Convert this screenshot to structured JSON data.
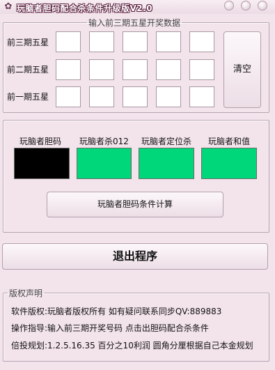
{
  "window": {
    "title": "玩脑者胆码配合杀条件升级版V2.0",
    "icon": "app-logo-icon"
  },
  "input_group": {
    "legend": "输入前三期五星开奖数据",
    "rows": [
      {
        "label": "前三期五星",
        "values": [
          "",
          "",
          "",
          "",
          ""
        ]
      },
      {
        "label": "前二期五星",
        "values": [
          "",
          "",
          "",
          "",
          ""
        ]
      },
      {
        "label": "前一期五星",
        "values": [
          "",
          "",
          "",
          "",
          ""
        ]
      }
    ],
    "clear_label": "清空"
  },
  "results": {
    "items": [
      {
        "label": "玩脑者胆码",
        "color": "#000000"
      },
      {
        "label": "玩脑者杀012",
        "color": "#00d67a"
      },
      {
        "label": "玩脑者定位杀",
        "color": "#00d67a"
      },
      {
        "label": "玩脑者和值",
        "color": "#00d67a"
      }
    ],
    "calc_label": "玩脑者胆码条件计算"
  },
  "exit_label": "退出程序",
  "copyright": {
    "legend": "版权声明",
    "lines": [
      "软件版权:玩脑者版权所有 如有疑问联系同步QV:889883",
      "操作指导:输入前三期开奖号码 点击出胆码配合杀条件",
      "倍投规划:1.2.5.16.35 百分之10利润 圆角分厘根据自己本金规划"
    ]
  }
}
